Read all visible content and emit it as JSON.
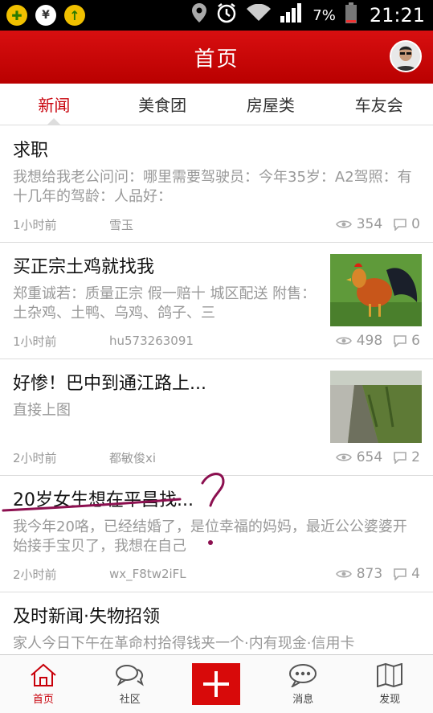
{
  "status_bar": {
    "battery_percent": "7%",
    "time": "21:21",
    "icons": [
      "plus-badge-icon",
      "shield-yen-icon",
      "upload-arrow-icon",
      "location-icon",
      "alarm-icon",
      "wifi-icon",
      "signal-icon",
      "battery-icon"
    ]
  },
  "header": {
    "title": "首页"
  },
  "tabs": [
    {
      "label": "新闻",
      "active": true
    },
    {
      "label": "美食团",
      "active": false
    },
    {
      "label": "房屋类",
      "active": false
    },
    {
      "label": "车友会",
      "active": false
    }
  ],
  "feed": [
    {
      "title": "求职",
      "summary": "我想给我老公问问：哪里需要驾驶员：今年35岁：A2驾照：有十几年的驾龄：人品好：",
      "time": "1小时前",
      "author": "雪玉",
      "views": "354",
      "comments": "0",
      "thumb": null
    },
    {
      "title": "买正宗土鸡就找我",
      "summary": "郑重诚若：质量正宗 假一赔十 城区配送 附售：土杂鸡、土鸭、乌鸡、鸽子、三",
      "time": "1小时前",
      "author": "hu573263091",
      "views": "498",
      "comments": "6",
      "thumb": "rooster"
    },
    {
      "title": "好惨！巴中到通江路上...",
      "summary": "直接上图",
      "time": "2小时前",
      "author": "都敏俊xi",
      "views": "654",
      "comments": "2",
      "thumb": "roadside"
    },
    {
      "title": "20岁女生想在平昌找...",
      "summary": "我今年20咯，已经结婚了，是位幸福的妈妈，最近公公婆婆开始接手宝贝了，我想在自己",
      "time": "2小时前",
      "author": "wx_F8tw2iFL",
      "views": "873",
      "comments": "4",
      "thumb": null
    },
    {
      "title": "及时新闻·失物招领",
      "summary": "家人今日下午在革命村拾得钱夹一个·内有现金·信用卡",
      "time": "",
      "author": "",
      "views": "",
      "comments": "",
      "thumb": null
    }
  ],
  "bottom_nav": [
    {
      "label": "首页",
      "icon": "home-icon",
      "active": true
    },
    {
      "label": "社区",
      "icon": "chat-bubbles-icon",
      "active": false
    },
    {
      "label": "",
      "icon": "plus-icon",
      "active": false
    },
    {
      "label": "消息",
      "icon": "message-icon",
      "active": false
    },
    {
      "label": "发现",
      "icon": "discover-icon",
      "active": false
    }
  ],
  "colors": {
    "brand_red": "#c8000a",
    "header_red": "#d80f10",
    "muted": "#999999"
  }
}
